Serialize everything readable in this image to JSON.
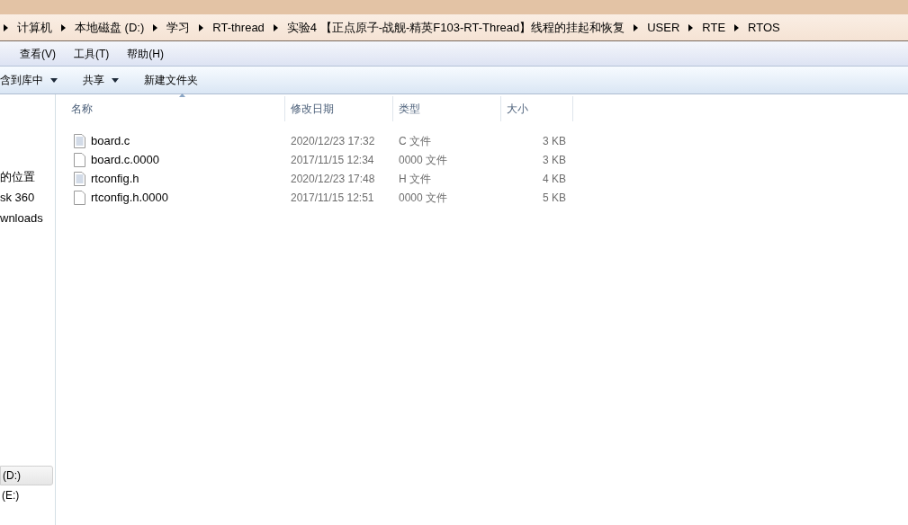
{
  "address_bar": {
    "path": [
      "计算机",
      "本地磁盘 (D:)",
      "学习",
      "RT-thread",
      "实验4 【正点原子-战舰-精英F103-RT-Thread】线程的挂起和恢复",
      "USER",
      "RTE",
      "RTOS"
    ]
  },
  "menu_bar": [
    "查看(V)",
    "工具(T)",
    "帮助(H)"
  ],
  "toolbar": [
    {
      "label": "含到库中",
      "dropdown": true
    },
    {
      "label": "共享",
      "dropdown": true
    },
    {
      "label": "新建文件夹",
      "dropdown": false
    }
  ],
  "sidebar": {
    "items": [
      {
        "label": "的位置",
        "selected": false
      },
      {
        "label": "sk 360",
        "selected": false
      },
      {
        "label": "wnloads",
        "selected": false
      }
    ],
    "drives": [
      {
        "label": "(D:)",
        "selected": true
      },
      {
        "label": "(E:)",
        "selected": false
      }
    ]
  },
  "table": {
    "columns": [
      "名称",
      "修改日期",
      "类型",
      "大小"
    ],
    "rows": [
      {
        "name": "board.c",
        "kind": "text",
        "modified": "2020/12/23 17:32",
        "type": "C 文件",
        "size": "3 KB"
      },
      {
        "name": "board.c.0000",
        "kind": "blank",
        "modified": "2017/11/15 12:34",
        "type": "0000 文件",
        "size": "3 KB"
      },
      {
        "name": "rtconfig.h",
        "kind": "text",
        "modified": "2020/12/23 17:48",
        "type": "H 文件",
        "size": "4 KB"
      },
      {
        "name": "rtconfig.h.0000",
        "kind": "blank",
        "modified": "2017/11/15 12:51",
        "type": "0000 文件",
        "size": "5 KB"
      }
    ]
  }
}
